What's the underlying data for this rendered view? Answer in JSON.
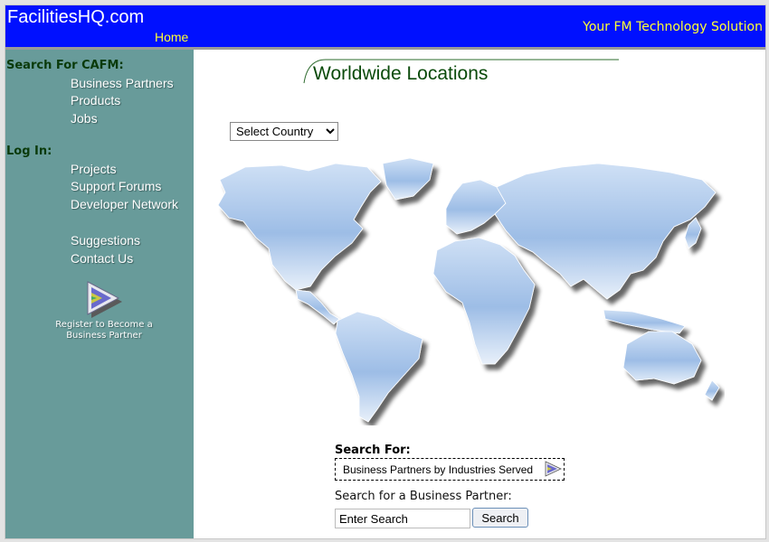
{
  "header": {
    "site_title": "FacilitiesHQ.com",
    "home_label": "Home",
    "tagline": "Your FM Technology Solution",
    "banner_color": "#0010ff",
    "tagline_color": "#ffff33"
  },
  "sidebar": {
    "background_color": "#689b9a",
    "search_heading": "Search For CAFM:",
    "search_links": [
      "Business Partners",
      "Products",
      "Jobs"
    ],
    "login_heading": "Log In:",
    "login_links": [
      "Projects",
      "Support Forums",
      "Developer Network"
    ],
    "extra_links": [
      "Suggestions",
      "Contact Us"
    ],
    "register": {
      "icon": "play-arrow-icon",
      "line1": "Register to Become a",
      "line2": "Business Partner"
    }
  },
  "main": {
    "title": "Worldwide Locations",
    "country_select": {
      "selected": "Select Country"
    },
    "map_icon": "world-map",
    "search_for_label": "Search For:",
    "industries_link": "Business Partners by Industries Served",
    "partner_search_label": "Search for a Business Partner:",
    "search_input_value": "Enter Search",
    "search_button_label": "Search"
  }
}
